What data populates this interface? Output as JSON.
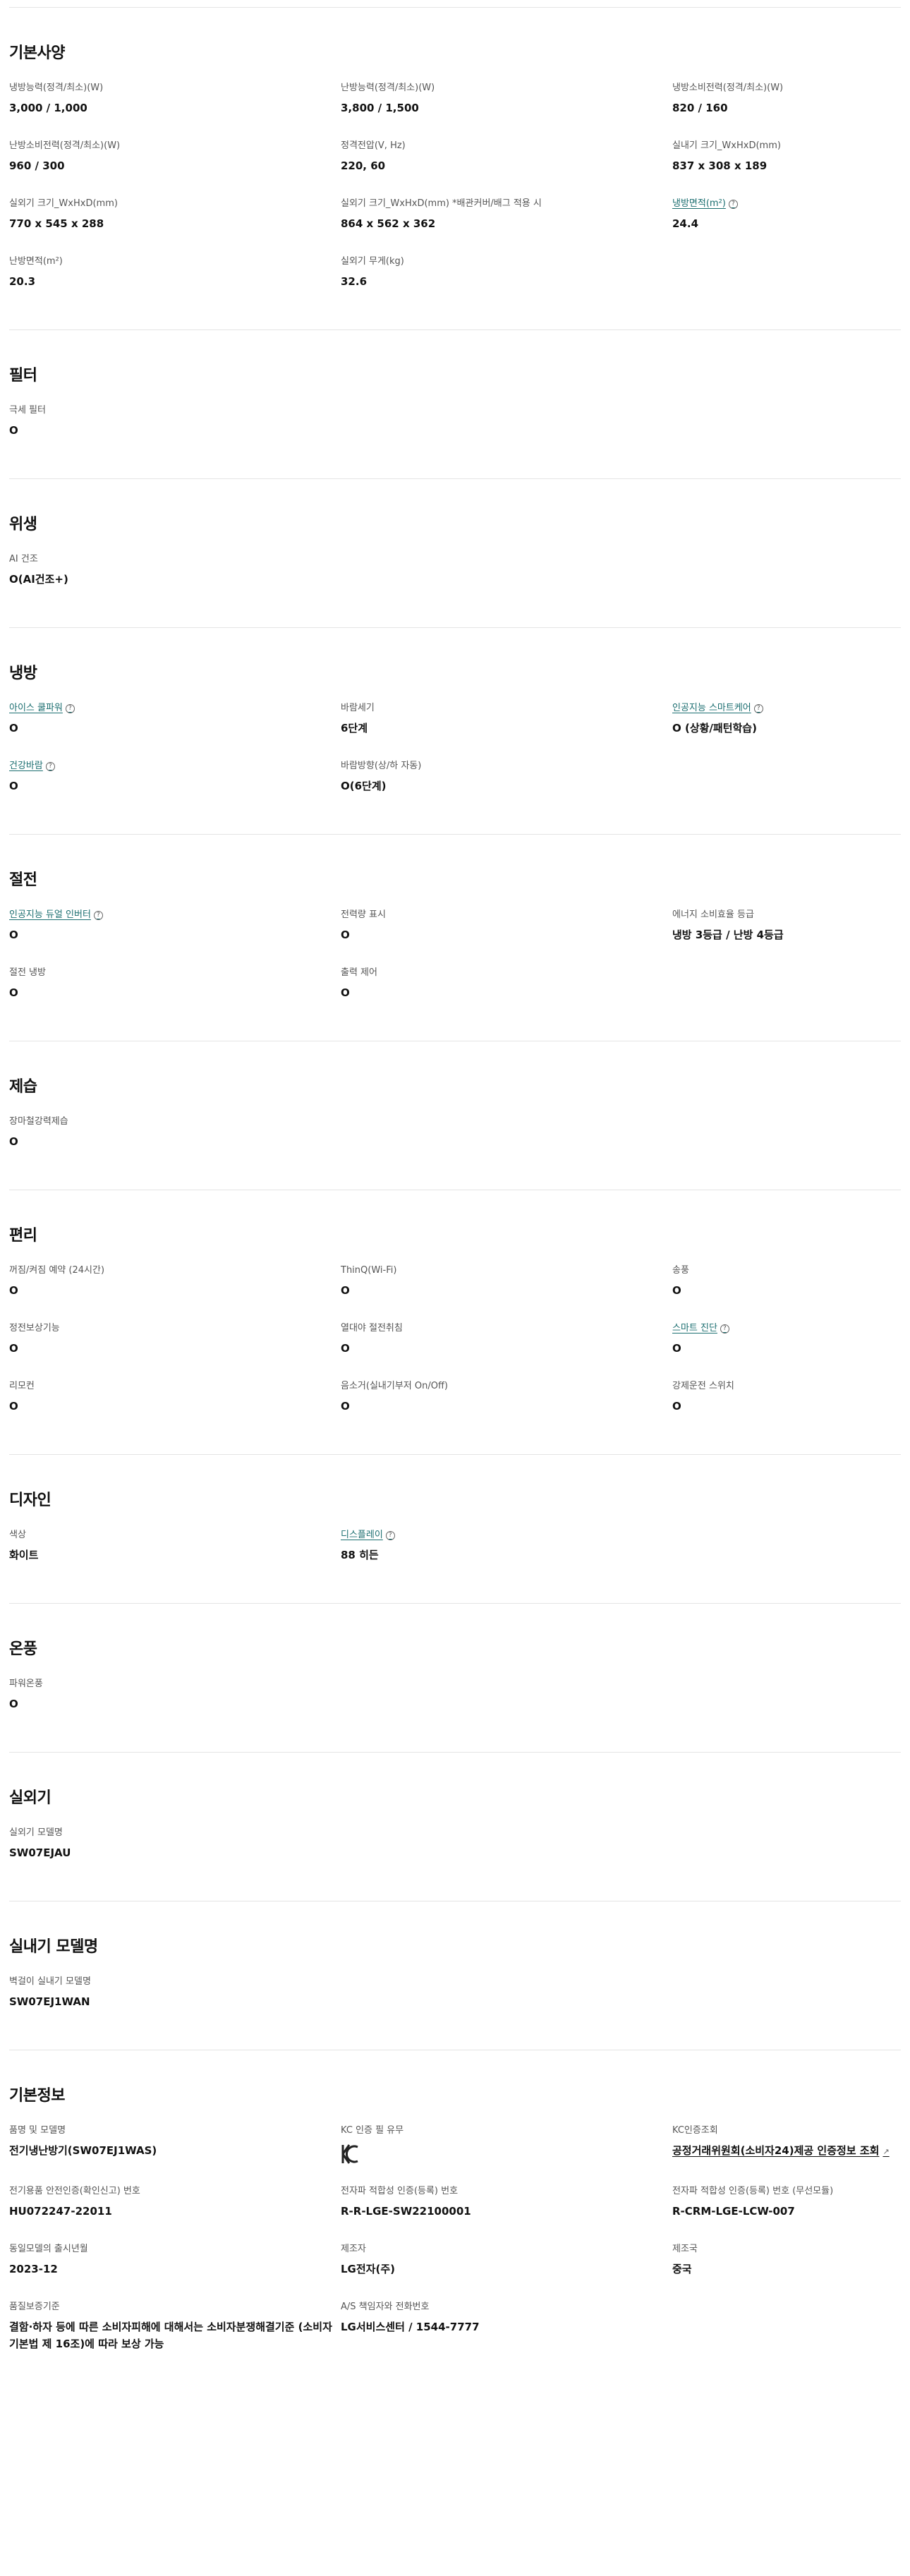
{
  "sections": [
    {
      "title": "기본사양",
      "items": [
        {
          "label": "냉방능력(정격/최소)(W)",
          "value": "3,000 / 1,000"
        },
        {
          "label": "난방능력(정격/최소)(W)",
          "value": "3,800 / 1,500"
        },
        {
          "label": "냉방소비전력(정격/최소)(W)",
          "value": "820 / 160"
        },
        {
          "label": "난방소비전력(정격/최소)(W)",
          "value": "960 / 300"
        },
        {
          "label": "정격전압(V, Hz)",
          "value": "220, 60"
        },
        {
          "label": "실내기 크기_WxHxD(mm)",
          "value": "837 x 308 x 189"
        },
        {
          "label": "실외기 크기_WxHxD(mm)",
          "value": "770 x 545 x 288"
        },
        {
          "label": "실외기 크기_WxHxD(mm) *배관커버/배그 적용 시",
          "value": "864 x 562 x 362"
        },
        {
          "label": "냉방면적(m²)",
          "value": "24.4",
          "link": true
        },
        {
          "label": "난방면적(m²)",
          "value": "20.3"
        },
        {
          "label": "실외기 무게(kg)",
          "value": "32.6"
        }
      ]
    },
    {
      "title": "필터",
      "items": [
        {
          "label": "극세 필터",
          "value": "O"
        }
      ]
    },
    {
      "title": "위생",
      "items": [
        {
          "label": "AI 건조",
          "value": "O(AI건조+)"
        }
      ]
    },
    {
      "title": "냉방",
      "items": [
        {
          "label": "아이스 쿨파워",
          "value": "O",
          "link": true
        },
        {
          "label": "바람세기",
          "value": "6단계"
        },
        {
          "label": "인공지능 스마트케어",
          "value": "O (상황/패턴학습)",
          "link": true
        },
        {
          "label": "건강바람",
          "value": "O",
          "link": true
        },
        {
          "label": "바람방향(상/하 자동)",
          "value": "O(6단계)"
        }
      ]
    },
    {
      "title": "절전",
      "items": [
        {
          "label": "인공지능 듀얼 인버터",
          "value": "O",
          "link": true
        },
        {
          "label": "전력량 표시",
          "value": "O"
        },
        {
          "label": "에너지 소비효율 등급",
          "value": "냉방 3등급 / 난방 4등급"
        },
        {
          "label": "절전 냉방",
          "value": "O"
        },
        {
          "label": "출력 제어",
          "value": "O"
        }
      ]
    },
    {
      "title": "제습",
      "items": [
        {
          "label": "장마철강력제습",
          "value": "O"
        }
      ]
    },
    {
      "title": "편리",
      "items": [
        {
          "label": "꺼짐/켜짐 예약 (24시간)",
          "value": "O"
        },
        {
          "label": "ThinQ(Wi-Fi)",
          "value": "O"
        },
        {
          "label": "송풍",
          "value": "O"
        },
        {
          "label": "정전보상기능",
          "value": "O"
        },
        {
          "label": "열대야 절전취침",
          "value": "O"
        },
        {
          "label": "스마트 진단",
          "value": "O",
          "link": true
        },
        {
          "label": "리모컨",
          "value": "O"
        },
        {
          "label": "음소거(실내기부저 On/Off)",
          "value": "O"
        },
        {
          "label": "강제운전 스위치",
          "value": "O"
        }
      ]
    },
    {
      "title": "디자인",
      "items": [
        {
          "label": "색상",
          "value": "화이트"
        },
        {
          "label": "디스플레이",
          "value": "88 히든",
          "link": true
        }
      ]
    },
    {
      "title": "온풍",
      "items": [
        {
          "label": "파워온풍",
          "value": "O"
        }
      ]
    },
    {
      "title": "실외기",
      "items": [
        {
          "label": "실외기 모델명",
          "value": "SW07EJAU"
        }
      ]
    },
    {
      "title": "실내기 모델명",
      "items": [
        {
          "label": "벽걸이 실내기 모델명",
          "value": "SW07EJ1WAN"
        }
      ]
    },
    {
      "title": "기본정보",
      "items": [
        {
          "label": "품명 및 모델명",
          "value": "전기냉난방기(SW07EJ1WAS)"
        },
        {
          "label": "KC 인증 필 유무",
          "value": "",
          "kc": true
        },
        {
          "label": "KC인증조회",
          "value": "공정거래위원회(소비자24)제공 인증정보 조회",
          "value_link": true
        },
        {
          "label": "전기용품 안전인증(확인신고) 번호",
          "value": "HU072247-22011"
        },
        {
          "label": "전자파 적합성 인증(등록) 번호",
          "value": "R-R-LGE-SW22100001"
        },
        {
          "label": "전자파 적합성 인증(등록) 번호 (무선모듈)",
          "value": "R-CRM-LGE-LCW-007"
        },
        {
          "label": "동일모델의 출시년월",
          "value": "2023-12"
        },
        {
          "label": "제조자",
          "value": "LG전자(주)"
        },
        {
          "label": "제조국",
          "value": "중국"
        },
        {
          "label": "품질보증기준",
          "value": "결함·하자 등에 따른 소비자피해에 대해서는 소비자분쟁해결기준 (소비자기본법 제 16조)에 따라 보상 가능"
        },
        {
          "label": "A/S 책임자와 전화번호",
          "value": "LG서비스센터 / 1544-7777"
        }
      ]
    }
  ],
  "icons": {
    "info": "info-circle-icon",
    "external": "external-link-icon",
    "kc": "kc-certification-mark"
  }
}
